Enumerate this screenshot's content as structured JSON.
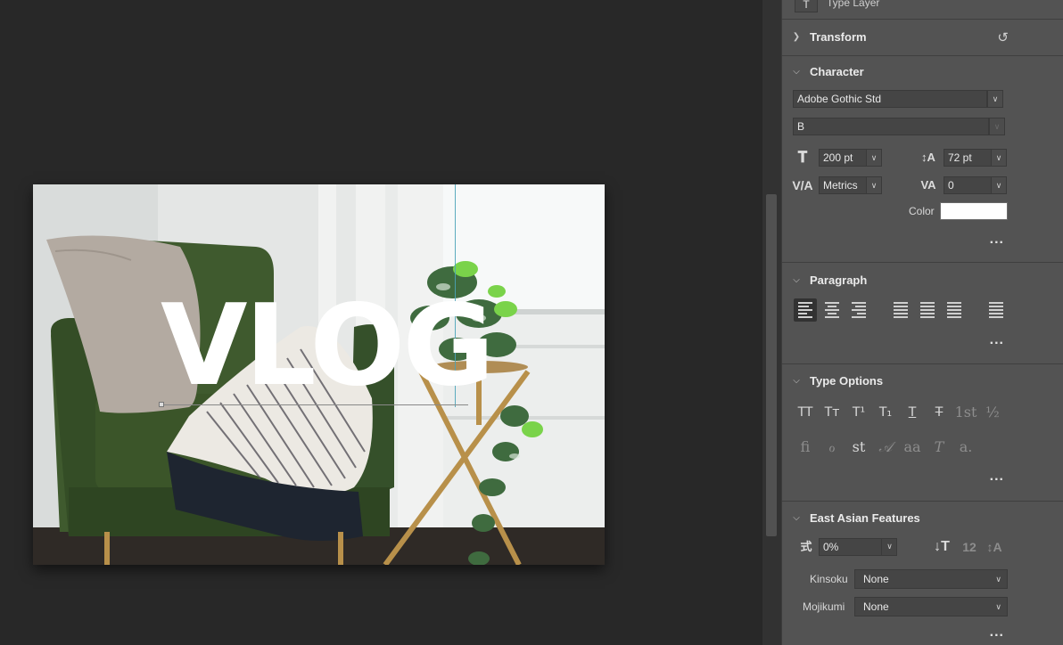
{
  "canvas": {
    "overlay_text": "VLOG"
  },
  "panel": {
    "layer_kind_icon": "T",
    "layer_kind_label": "Type Layer",
    "transform": {
      "title": "Transform",
      "icon": "reset-icon"
    },
    "character": {
      "title": "Character",
      "font_family": "Adobe Gothic Std",
      "font_style": "B",
      "font_size": "200 pt",
      "leading": "72 pt",
      "kerning": "Metrics",
      "tracking": "0",
      "color_label": "Color",
      "color_value": "#ffffff",
      "more": "..."
    },
    "paragraph": {
      "title": "Paragraph",
      "more": "..."
    },
    "type_options": {
      "title": "Type Options",
      "row1": [
        "TT",
        "Tт",
        "T¹",
        "T₁",
        "T",
        "T",
        "1st",
        "½"
      ],
      "row2": [
        "fi",
        "ℴ",
        "st",
        "𝒜",
        "aa",
        "T",
        "a."
      ],
      "more": "..."
    },
    "east_asian": {
      "title": "East Asian Features",
      "tsume": "0%",
      "kinsoku_label": "Kinsoku",
      "kinsoku_value": "None",
      "mojikumi_label": "Mojikumi",
      "mojikumi_value": "None",
      "more": "..."
    }
  },
  "colors": {
    "canvas_bg": "#282828",
    "panel_bg": "#535353",
    "field_bg": "#454545",
    "guide": "#4aa3b8"
  }
}
